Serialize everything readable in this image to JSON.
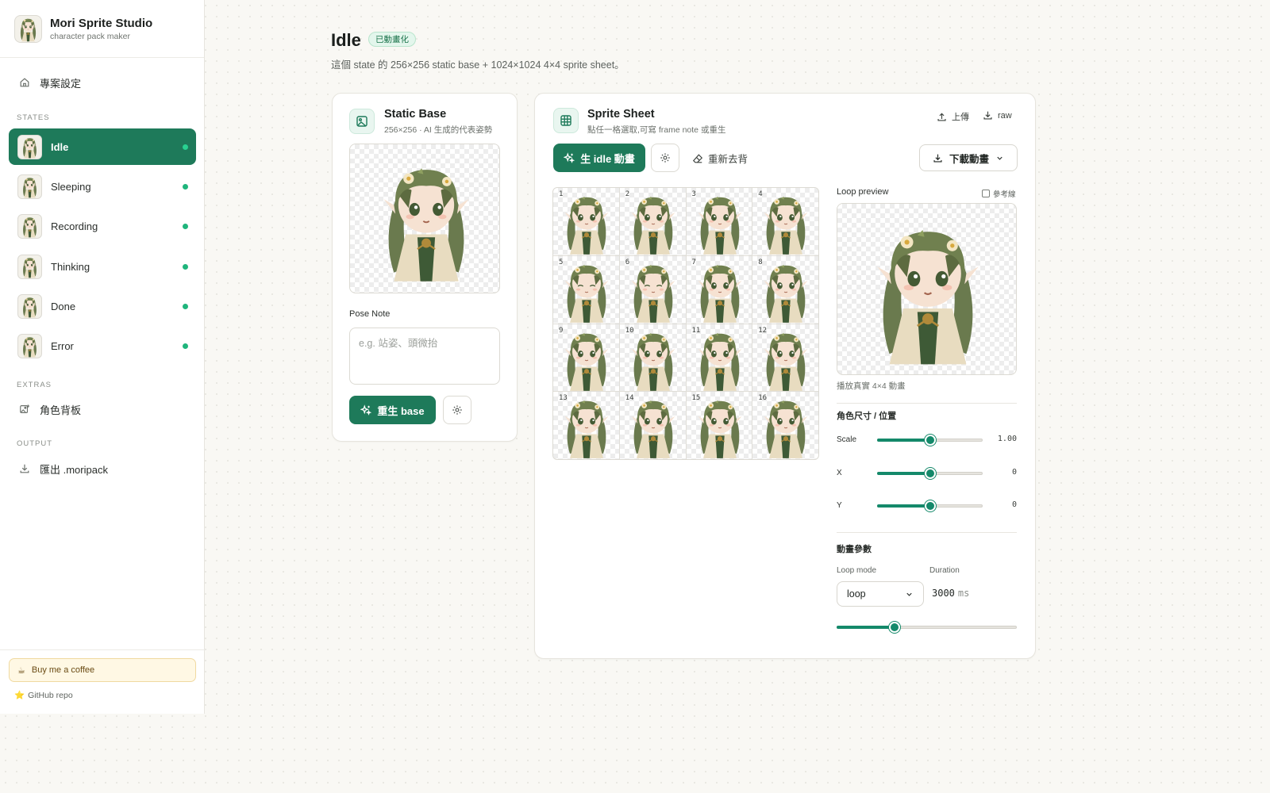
{
  "brand": {
    "title": "Mori Sprite Studio",
    "subtitle": "character pack maker"
  },
  "sidebar": {
    "project_settings": "專案設定",
    "states_label": "STATES",
    "states": [
      {
        "label": "Idle",
        "active": true
      },
      {
        "label": "Sleeping"
      },
      {
        "label": "Recording"
      },
      {
        "label": "Thinking"
      },
      {
        "label": "Done"
      },
      {
        "label": "Error"
      }
    ],
    "extras_label": "EXTRAS",
    "extras_item": "角色背板",
    "output_label": "OUTPUT",
    "output_item": "匯出 .moripack",
    "coffee": "Buy me a coffee",
    "coffee_icon": "☕",
    "github": "GitHub repo",
    "github_icon": "⭐"
  },
  "header": {
    "title": "Idle",
    "badge": "已動畫化",
    "description": "這個 state 的 256×256 static base + 1024×1024 4×4 sprite sheet。"
  },
  "static_base": {
    "title": "Static Base",
    "subtitle": "256×256 · AI 生成的代表姿勢",
    "pose_note_label": "Pose Note",
    "pose_note_placeholder": "e.g. 站姿、頭微抬",
    "regen_button": "重生 base"
  },
  "sprite_sheet": {
    "title": "Sprite Sheet",
    "subtitle": "點任一格選取,可寫 frame note 或重生",
    "upload": "上傳",
    "raw": "raw",
    "generate_button": "生 idle 動畫",
    "remove_bg": "重新去背",
    "download": "下載動畫",
    "frames": [
      "1",
      "2",
      "3",
      "4",
      "5",
      "6",
      "7",
      "8",
      "9",
      "10",
      "11",
      "12",
      "13",
      "14",
      "15",
      "16"
    ]
  },
  "preview": {
    "title": "Loop preview",
    "guides": "參考線",
    "caption": "播放真實 4×4 動畫"
  },
  "size_position": {
    "title": "角色尺寸 / 位置",
    "sliders": [
      {
        "label": "Scale",
        "display": "1.00",
        "fraction": 0.5
      },
      {
        "label": "X",
        "display": "0",
        "fraction": 0.5
      },
      {
        "label": "Y",
        "display": "0",
        "fraction": 0.5
      }
    ]
  },
  "animation": {
    "title": "動畫參數",
    "loop_mode_label": "Loop mode",
    "loop_mode_value": "loop",
    "duration_label": "Duration",
    "duration_value": "3000",
    "duration_unit": "ms",
    "duration_fraction": 0.32
  },
  "colors": {
    "accent": "#1e7a5a",
    "active_dot": "#1fb57c",
    "slider": "#14896a"
  }
}
